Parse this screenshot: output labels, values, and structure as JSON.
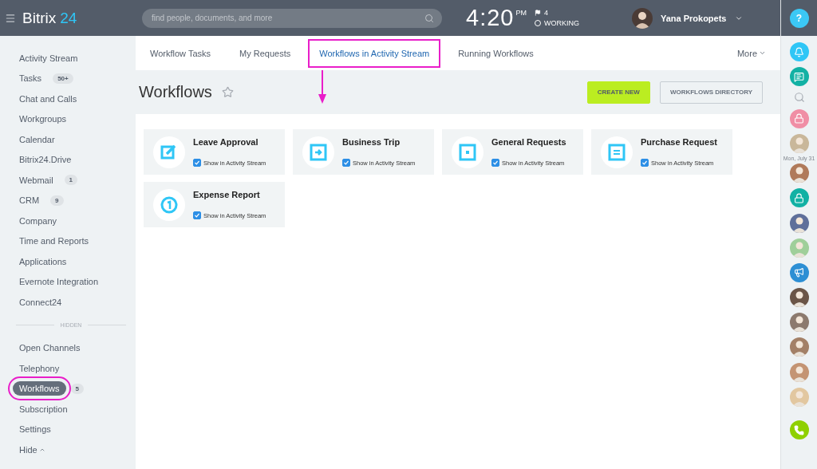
{
  "header": {
    "logo": "Bitrix",
    "logo_accent": "24",
    "search_placeholder": "find people, documents, and more",
    "time": "4:20",
    "ampm": "PM",
    "flag_count": "4",
    "status": "WORKING",
    "user": "Yana Prokopets",
    "help": "?"
  },
  "sidebar": {
    "items": [
      {
        "label": "Activity Stream",
        "selected": false,
        "highlighted": false
      },
      {
        "label": "Tasks",
        "counter": "50+",
        "selected": false,
        "highlighted": false
      },
      {
        "label": "Chat and Calls",
        "selected": false,
        "highlighted": false
      },
      {
        "label": "Workgroups",
        "selected": false,
        "highlighted": false
      },
      {
        "label": "Calendar",
        "selected": false,
        "highlighted": false
      },
      {
        "label": "Bitrix24.Drive",
        "selected": false,
        "highlighted": false
      },
      {
        "label": "Webmail",
        "counter": "1",
        "selected": false,
        "highlighted": false
      },
      {
        "label": "CRM",
        "counter": "9",
        "selected": false,
        "highlighted": false
      },
      {
        "label": "Company",
        "selected": false,
        "highlighted": false
      },
      {
        "label": "Time and Reports",
        "selected": false,
        "highlighted": false
      },
      {
        "label": "Applications",
        "selected": false,
        "highlighted": false
      },
      {
        "label": "Evernote Integration",
        "selected": false,
        "highlighted": false
      },
      {
        "label": "Connect24",
        "selected": false,
        "highlighted": false
      }
    ],
    "hidden_label": "HIDDEN",
    "hidden_items": [
      {
        "label": "Open Channels",
        "selected": false,
        "highlighted": false
      },
      {
        "label": "Telephony",
        "selected": false,
        "highlighted": false
      },
      {
        "label": "Workflows",
        "counter": "5",
        "selected": true,
        "highlighted": true
      },
      {
        "label": "Subscription",
        "selected": false,
        "highlighted": false
      },
      {
        "label": "Settings",
        "selected": false,
        "highlighted": false
      }
    ],
    "toggle": "Hide"
  },
  "tabs": [
    {
      "label": "Workflow Tasks",
      "selected": false,
      "highlighted": false
    },
    {
      "label": "My Requests",
      "selected": false,
      "highlighted": false
    },
    {
      "label": "Workflows in Activity Stream",
      "selected": true,
      "highlighted": true
    },
    {
      "label": "Running Workflows",
      "selected": false,
      "highlighted": false
    }
  ],
  "more": "More",
  "page": {
    "title": "Workflows",
    "annotation_arrow": true,
    "buttons": [
      {
        "label": "CREATE NEW",
        "kind": "primary"
      },
      {
        "label": "WORKFLOWS DIRECTORY",
        "kind": "secondary"
      }
    ]
  },
  "workflows": [
    {
      "title": "Leave Approval",
      "kind": "edit",
      "checked": true,
      "check_label": "Show in Activity Stream"
    },
    {
      "title": "Business Trip",
      "kind": "arrow",
      "checked": true,
      "check_label": "Show in Activity Stream"
    },
    {
      "title": "General Requests",
      "kind": "square",
      "checked": true,
      "check_label": "Show in Activity Stream"
    },
    {
      "title": "Purchase Request",
      "kind": "list",
      "checked": true,
      "check_label": "Show in Activity Stream"
    },
    {
      "title": "Expense Report",
      "kind": "coin",
      "checked": true,
      "check_label": "Show in Activity Stream"
    }
  ],
  "right_bar": [
    {
      "kind": "bell",
      "color": "#2fc6f6"
    },
    {
      "kind": "chat",
      "color": "#12b1a4"
    },
    {
      "kind": "search"
    },
    {
      "kind": "lock",
      "color": "#f08ea5"
    },
    {
      "kind": "avatar",
      "color": "#c9b79a"
    },
    {
      "kind": "date",
      "label": "Mon, July 31"
    },
    {
      "kind": "avatar",
      "color": "#b07a5a"
    },
    {
      "kind": "lock",
      "color": "#12b1a4"
    },
    {
      "kind": "avatar",
      "color": "#5f6f9a"
    },
    {
      "kind": "avatar",
      "color": "#9fcf9a"
    },
    {
      "kind": "megaphone",
      "color": "#2d8fd4"
    },
    {
      "kind": "avatar",
      "color": "#6b5547"
    },
    {
      "kind": "avatar",
      "color": "#8c7a6e"
    },
    {
      "kind": "avatar",
      "color": "#a38067"
    },
    {
      "kind": "avatar",
      "color": "#c49473"
    },
    {
      "kind": "avatar",
      "color": "#e2c7a0"
    },
    {
      "kind": "phone",
      "color": "#8fd000"
    }
  ]
}
